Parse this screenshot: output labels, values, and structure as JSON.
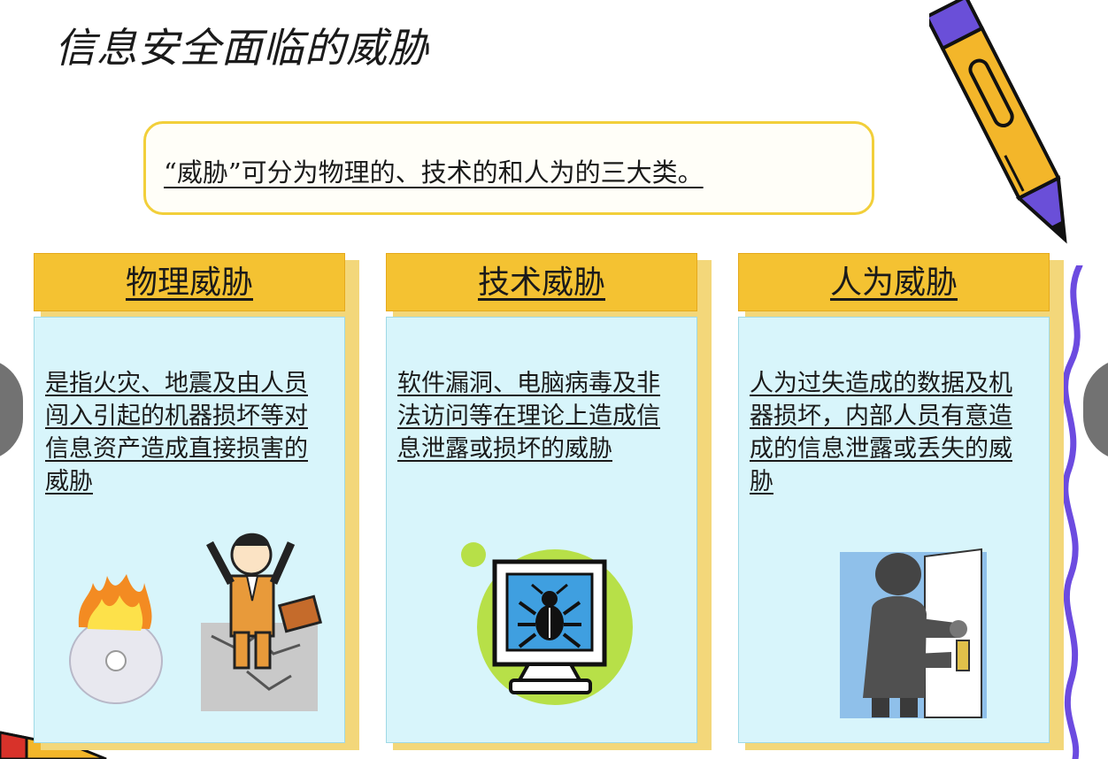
{
  "slide": {
    "title": "信息安全面临的威胁",
    "intro": "“威胁”可分为物理的、技术的和人为的三大类。",
    "cards": [
      {
        "heading": "物理威胁",
        "description": "是指火灾、地震及由人员闯入引起的机器损坏等对信息资产造成直接损害的威胁",
        "art": "fire-cd-earthquake-illustration"
      },
      {
        "heading": "技术威胁",
        "description": "软件漏洞、电脑病毒及非法访问等在理论上造成信息泄露或损坏的威胁",
        "art": "computer-virus-bug-illustration"
      },
      {
        "heading": "人为威胁",
        "description": "人为过失造成的数据及机器损坏，内部人员有意造成的信息泄露或丢失的威胁",
        "art": "intruder-door-illustration"
      }
    ]
  },
  "icons": {
    "prev": "chevron-left-icon",
    "next": "chevron-right-icon",
    "pencil": "pencil-decoration",
    "squiggle": "squiggle-decoration"
  },
  "colors": {
    "header_yellow": "#f4c232",
    "card_blue": "#d8f5fb",
    "border_yellow": "#f2cf3a",
    "squiggle_purple": "#6c4be0"
  }
}
